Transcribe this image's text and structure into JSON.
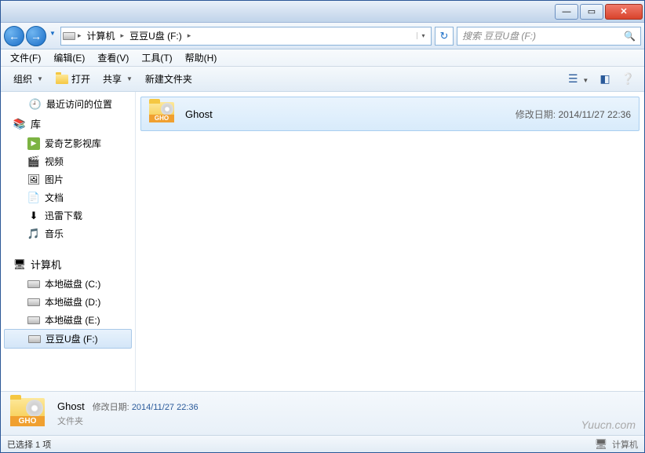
{
  "titlebar": {
    "min": "—",
    "max": "▭",
    "close": "✕"
  },
  "nav": {
    "back": "←",
    "fwd": "→",
    "path": {
      "computer": "计算机",
      "drive": "豆豆U盘 (F:)"
    },
    "refresh": "↻",
    "search_placeholder": "搜索 豆豆U盘 (F:)"
  },
  "menu": {
    "file": "文件(F)",
    "edit": "编辑(E)",
    "view": "查看(V)",
    "tools": "工具(T)",
    "help": "帮助(H)"
  },
  "toolbar": {
    "organize": "组织",
    "open": "打开",
    "share": "共享",
    "new_folder": "新建文件夹"
  },
  "sidebar": {
    "recent": "最近访问的位置",
    "libraries": {
      "label": "库",
      "items": [
        "爱奇艺影视库",
        "视频",
        "图片",
        "文档",
        "迅雷下载",
        "音乐"
      ]
    },
    "computer": {
      "label": "计算机",
      "drives": [
        "本地磁盘 (C:)",
        "本地磁盘 (D:)",
        "本地磁盘 (E:)",
        "豆豆U盘 (F:)"
      ]
    }
  },
  "content": {
    "items": [
      {
        "name": "Ghost",
        "gho": "GHO",
        "date_label": "修改日期:",
        "date": "2014/11/27 22:36"
      }
    ]
  },
  "details": {
    "name": "Ghost",
    "type": "文件夹",
    "gho": "GHO",
    "date_label": "修改日期:",
    "date": "2014/11/27 22:36"
  },
  "status": {
    "text": "已选择 1 项",
    "computer": "计算机"
  },
  "watermark": "Yuucn.com"
}
